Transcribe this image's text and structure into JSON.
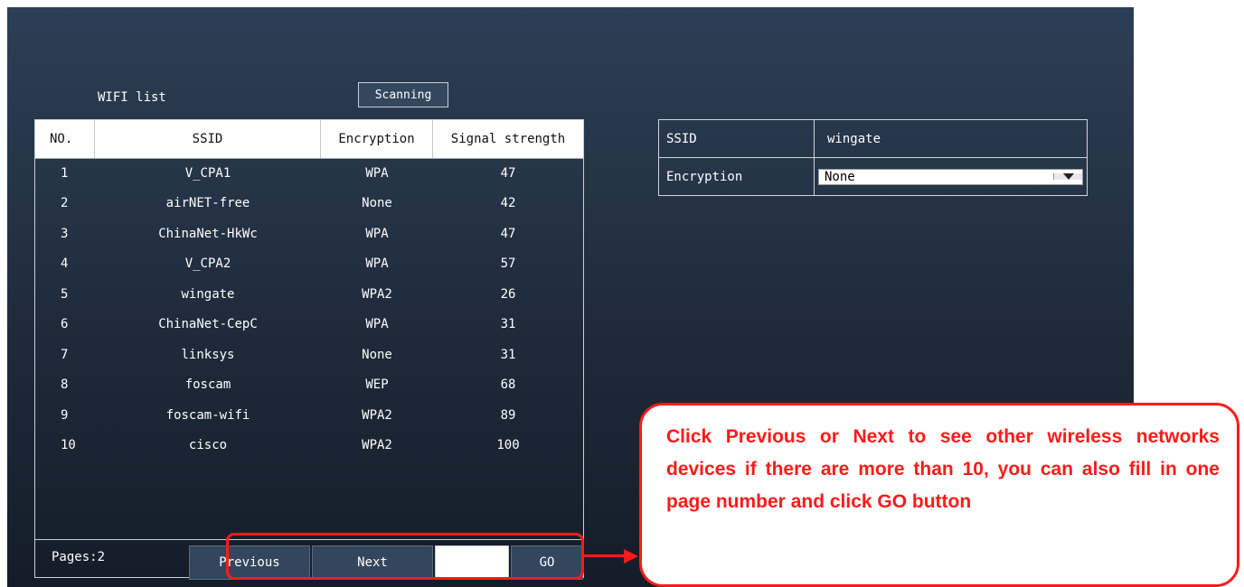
{
  "wifi_list": {
    "title": "WIFI list",
    "scan_label": "Scanning",
    "columns": [
      "NO.",
      "SSID",
      "Encryption",
      "Signal strength"
    ],
    "rows": [
      {
        "no": "1",
        "ssid": "V_CPA1",
        "encryption": "WPA",
        "signal": "47"
      },
      {
        "no": "2",
        "ssid": "airNET-free",
        "encryption": "None",
        "signal": "42"
      },
      {
        "no": "3",
        "ssid": "ChinaNet-HkWc",
        "encryption": "WPA",
        "signal": "47"
      },
      {
        "no": "4",
        "ssid": "V_CPA2",
        "encryption": "WPA",
        "signal": "57"
      },
      {
        "no": "5",
        "ssid": "wingate",
        "encryption": "WPA2",
        "signal": "26"
      },
      {
        "no": "6",
        "ssid": "ChinaNet-CepC",
        "encryption": "WPA",
        "signal": "31"
      },
      {
        "no": "7",
        "ssid": "linksys",
        "encryption": "None",
        "signal": "31"
      },
      {
        "no": "8",
        "ssid": "foscam",
        "encryption": "WEP",
        "signal": "68"
      },
      {
        "no": "9",
        "ssid": "foscam-wifi",
        "encryption": "WPA2",
        "signal": "89"
      },
      {
        "no": "10",
        "ssid": "cisco",
        "encryption": "WPA2",
        "signal": "100"
      }
    ],
    "footer": {
      "pages_label": "Pages:2",
      "previous_label": "Previous",
      "next_label": "Next",
      "page_input_value": "",
      "go_label": "GO"
    }
  },
  "selected_network": {
    "ssid_label": "SSID",
    "ssid_value": "wingate",
    "encryption_label": "Encryption",
    "encryption_value": "None"
  },
  "callout": {
    "text": "Click Previous or Next to see other wireless networks devices if there are more than 10, you can also fill in one page number and click GO button"
  },
  "colors": {
    "accent": "#ff1a1a",
    "panel": "#1f2b3b"
  }
}
